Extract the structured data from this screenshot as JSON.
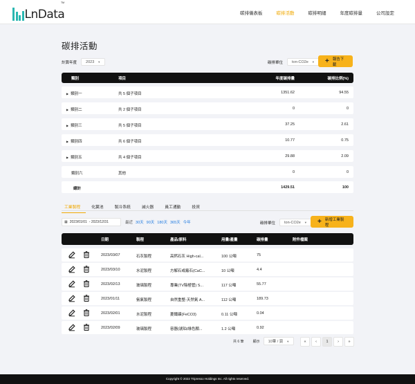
{
  "brand": {
    "name": "LnData",
    "tm": "TM",
    "color": "#2ab7b1"
  },
  "nav": [
    {
      "label": "碳排儀表板"
    },
    {
      "label": "碳排活動",
      "active": true
    },
    {
      "label": "碳排明細"
    },
    {
      "label": "年度碳排量"
    },
    {
      "label": "公司設定"
    }
  ],
  "page": {
    "title": "碳排活動",
    "year_label": "計算年度",
    "year_value": "2023",
    "unit_label": "碳排單位",
    "unit_value": "ton-CO2e",
    "report_button": "報告下載"
  },
  "summary": {
    "headers": [
      "類別",
      "項目",
      "年度碳排量",
      "碳排比例(%)"
    ],
    "rows": [
      {
        "category": "類別一",
        "item": "共 5 個子項目",
        "amount": "1351.62",
        "ratio": "94.55",
        "expandable": true
      },
      {
        "category": "類別二",
        "item": "共 2 個子項目",
        "amount": "0",
        "ratio": "0",
        "expandable": true
      },
      {
        "category": "類別三",
        "item": "共 5 個子項目",
        "amount": "37.25",
        "ratio": "2.61",
        "expandable": true
      },
      {
        "category": "類別四",
        "item": "共 6 個子項目",
        "amount": "10.77",
        "ratio": "0.75",
        "expandable": true
      },
      {
        "category": "類別五",
        "item": "共 4 個子項目",
        "amount": "29.88",
        "ratio": "2.09",
        "expandable": true
      },
      {
        "category": "類別六",
        "item": "其他",
        "amount": "0",
        "ratio": "0",
        "expandable": false
      }
    ],
    "total": {
      "label": "總計",
      "amount": "1429.51",
      "ratio": "100"
    }
  },
  "tabs": [
    {
      "label": "工業製程",
      "active": true
    },
    {
      "label": "化糞池"
    },
    {
      "label": "製冷系統"
    },
    {
      "label": "滅火器"
    },
    {
      "label": "員工通勤"
    },
    {
      "label": "投資"
    }
  ],
  "filter": {
    "date_start": "2023/01/01",
    "date_sep": "- 2023/12/31",
    "quick_label": "最近",
    "quick_links": [
      "30天",
      "90天",
      "180天",
      "365天",
      "今年"
    ],
    "unit_label": "碳排單位",
    "unit_value": "ton-CO2e",
    "add_button": "新增工業製程"
  },
  "process": {
    "headers": [
      "日期",
      "製程",
      "產品/原料",
      "用量/產量",
      "碳排量",
      "附件檔案"
    ],
    "rows": [
      {
        "date": "2023/03/07",
        "process": "石灰製程",
        "material": "高鈣石灰 High-cal...",
        "qty": "100 公噸",
        "emission": "75",
        "attachment": ""
      },
      {
        "date": "2023/03/10",
        "process": "水泥製程",
        "material": "方解石或霰石(CaC...",
        "qty": "10 公噸",
        "emission": "4.4",
        "attachment": ""
      },
      {
        "date": "2023/02/13",
        "process": "玻璃製程",
        "material": "專業(TV陰極管) S...",
        "qty": "117 公噸",
        "emission": "55.77",
        "attachment": ""
      },
      {
        "date": "2023/01/11",
        "process": "氨氣製程",
        "material": "自然重整-天然氣 A...",
        "qty": "112 公噸",
        "emission": "189.73",
        "attachment": ""
      },
      {
        "date": "2023/02/01",
        "process": "水泥製程",
        "material": "菱鐵礦(FeCO3)",
        "qty": "0.11 公噸",
        "emission": "0.04",
        "attachment": ""
      },
      {
        "date": "2023/02/09",
        "process": "玻璃製程",
        "material": "容器(琥珀/綠色顏...",
        "qty": "1.2 公噸",
        "emission": "0.92",
        "attachment": ""
      }
    ]
  },
  "pagination": {
    "total_text": "共 6 筆",
    "show_label": "顯示",
    "per_page": "10筆 / 頁",
    "first": "«",
    "prev": "‹",
    "current": "1",
    "next": "›",
    "last": "»"
  },
  "footer": {
    "text": "Copyright © 2022 Tripresso Holdings Inc. All rights reserved."
  }
}
